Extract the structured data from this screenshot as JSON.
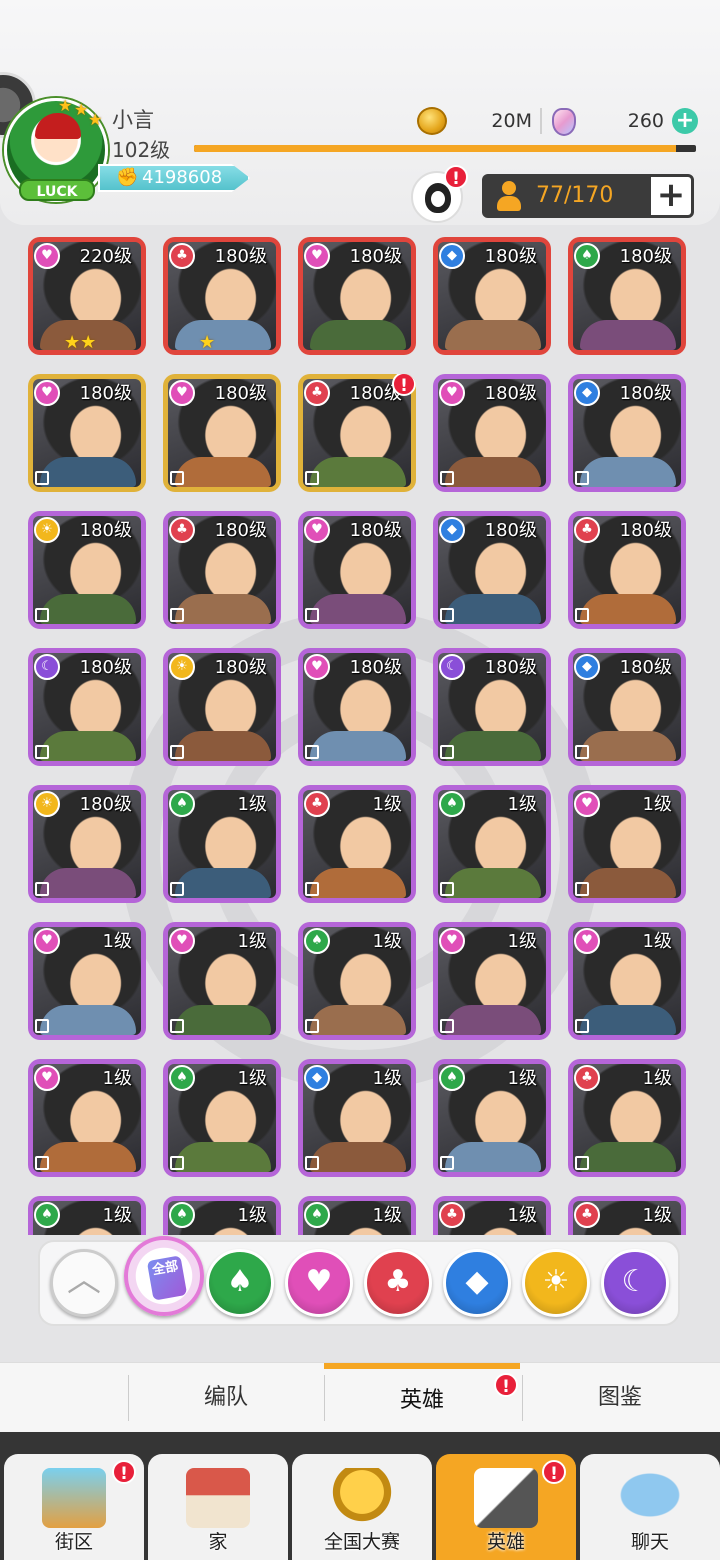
{
  "player": {
    "name": "小言",
    "level": "102级",
    "power": "4198608",
    "xp_fraction": 0.96,
    "avatar_badge": "LUCK"
  },
  "currency": {
    "coins": "20M",
    "gems": "260"
  },
  "roster": {
    "count": "77/170"
  },
  "heroes": [
    {
      "level": "220级",
      "element": "heart",
      "rarity": "red",
      "stars": 2
    },
    {
      "level": "180级",
      "element": "club",
      "rarity": "red",
      "stars": 1
    },
    {
      "level": "180级",
      "element": "heart",
      "rarity": "red",
      "stars": 0
    },
    {
      "level": "180级",
      "element": "diamond",
      "rarity": "red",
      "stars": 0
    },
    {
      "level": "180级",
      "element": "spade",
      "rarity": "red",
      "stars": 0
    },
    {
      "level": "180级",
      "element": "heart",
      "rarity": "gold",
      "stars": 0
    },
    {
      "level": "180级",
      "element": "heart",
      "rarity": "gold",
      "stars": 0
    },
    {
      "level": "180级",
      "element": "club",
      "rarity": "gold",
      "stars": 0,
      "alert": true
    },
    {
      "level": "180级",
      "element": "heart",
      "rarity": "purple",
      "stars": 0
    },
    {
      "level": "180级",
      "element": "diamond",
      "rarity": "purple",
      "stars": 0
    },
    {
      "level": "180级",
      "element": "sun",
      "rarity": "purple",
      "stars": 0
    },
    {
      "level": "180级",
      "element": "club",
      "rarity": "purple",
      "stars": 0
    },
    {
      "level": "180级",
      "element": "heart",
      "rarity": "purple",
      "stars": 0
    },
    {
      "level": "180级",
      "element": "diamond",
      "rarity": "purple",
      "stars": 0
    },
    {
      "level": "180级",
      "element": "club",
      "rarity": "purple",
      "stars": 0
    },
    {
      "level": "180级",
      "element": "moon",
      "rarity": "purple",
      "stars": 0
    },
    {
      "level": "180级",
      "element": "sun",
      "rarity": "purple",
      "stars": 0
    },
    {
      "level": "180级",
      "element": "heart",
      "rarity": "purple",
      "stars": 0
    },
    {
      "level": "180级",
      "element": "moon",
      "rarity": "purple",
      "stars": 0
    },
    {
      "level": "180级",
      "element": "diamond",
      "rarity": "purple",
      "stars": 0
    },
    {
      "level": "180级",
      "element": "sun",
      "rarity": "purple",
      "stars": 0
    },
    {
      "level": "1级",
      "element": "spade",
      "rarity": "purple",
      "stars": 0
    },
    {
      "level": "1级",
      "element": "club",
      "rarity": "purple",
      "stars": 0
    },
    {
      "level": "1级",
      "element": "spade",
      "rarity": "purple",
      "stars": 0
    },
    {
      "level": "1级",
      "element": "heart",
      "rarity": "purple",
      "stars": 0
    },
    {
      "level": "1级",
      "element": "heart",
      "rarity": "purple",
      "stars": 0
    },
    {
      "level": "1级",
      "element": "heart",
      "rarity": "purple",
      "stars": 0
    },
    {
      "level": "1级",
      "element": "spade",
      "rarity": "purple",
      "stars": 0
    },
    {
      "level": "1级",
      "element": "heart",
      "rarity": "purple",
      "stars": 0
    },
    {
      "level": "1级",
      "element": "heart",
      "rarity": "purple",
      "stars": 0
    },
    {
      "level": "1级",
      "element": "heart",
      "rarity": "purple",
      "stars": 0
    },
    {
      "level": "1级",
      "element": "spade",
      "rarity": "purple",
      "stars": 0
    },
    {
      "level": "1级",
      "element": "diamond",
      "rarity": "purple",
      "stars": 0
    },
    {
      "level": "1级",
      "element": "spade",
      "rarity": "purple",
      "stars": 0
    },
    {
      "level": "1级",
      "element": "club",
      "rarity": "purple",
      "stars": 0
    },
    {
      "level": "1级",
      "element": "spade",
      "rarity": "purple",
      "stars": 0
    },
    {
      "level": "1级",
      "element": "spade",
      "rarity": "purple",
      "stars": 0
    },
    {
      "level": "1级",
      "element": "spade",
      "rarity": "purple",
      "stars": 0
    },
    {
      "level": "1级",
      "element": "club",
      "rarity": "purple",
      "stars": 0
    },
    {
      "level": "1级",
      "element": "club",
      "rarity": "purple",
      "stars": 0
    }
  ],
  "filters": {
    "all_label": "全部",
    "items": [
      "spade",
      "heart",
      "club",
      "diamond",
      "sun",
      "moon"
    ]
  },
  "tabs": [
    "编队",
    "英雄",
    "图鉴"
  ],
  "active_tab": 1,
  "nav": [
    "街区",
    "家",
    "全国大赛",
    "英雄",
    "聊天"
  ],
  "active_nav": 3,
  "alert_mark": "!",
  "colors": {
    "accent": "#f5a623",
    "rarity": {
      "red": "#e0453c",
      "gold": "#e0b23a",
      "purple": "#b565d8"
    },
    "element": {
      "spade": "#2ea84a",
      "heart": "#e04fb8",
      "club": "#e0414f",
      "diamond": "#2f7fe0",
      "sun": "#f2b71c",
      "moon": "#8a4fd8"
    }
  }
}
